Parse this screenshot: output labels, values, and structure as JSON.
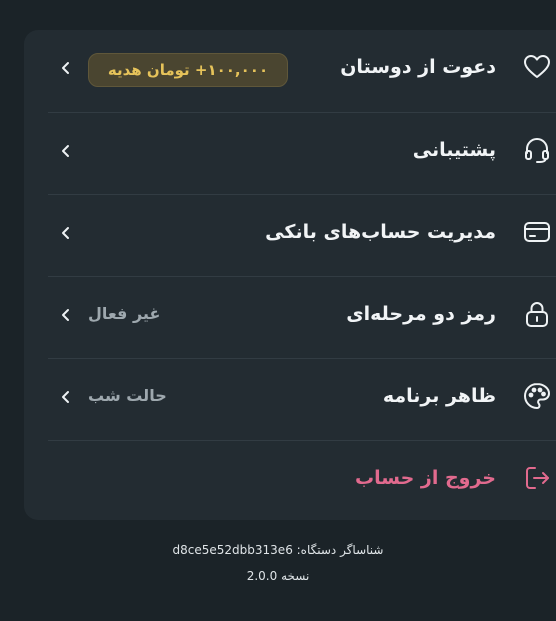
{
  "menu": {
    "invite": {
      "label": "دعوت از دوستان",
      "badge": "۱۰۰,۰۰۰+ تومان هدیه",
      "icon": "heart-icon"
    },
    "support": {
      "label": "پشتیبانی",
      "icon": "headset-icon"
    },
    "bank_accounts": {
      "label": "مدیریت حساب‌های بانکی",
      "icon": "credit-card-icon"
    },
    "two_factor": {
      "label": "رمز دو مرحله‌ای",
      "value": "غیر فعال",
      "icon": "lock-icon"
    },
    "appearance": {
      "label": "ظاهر برنامه",
      "value": "حالت شب",
      "icon": "palette-icon"
    },
    "logout": {
      "label": "خروج از حساب",
      "icon": "logout-icon"
    }
  },
  "footer": {
    "device_id": "شناساگر دستگاه: d8ce5e52dbb313e6",
    "version": "نسخه 2.0.0"
  },
  "colors": {
    "background": "#1b2328",
    "card": "#232c32",
    "badge_text": "#e6c35a",
    "logout": "#e16a8e"
  }
}
